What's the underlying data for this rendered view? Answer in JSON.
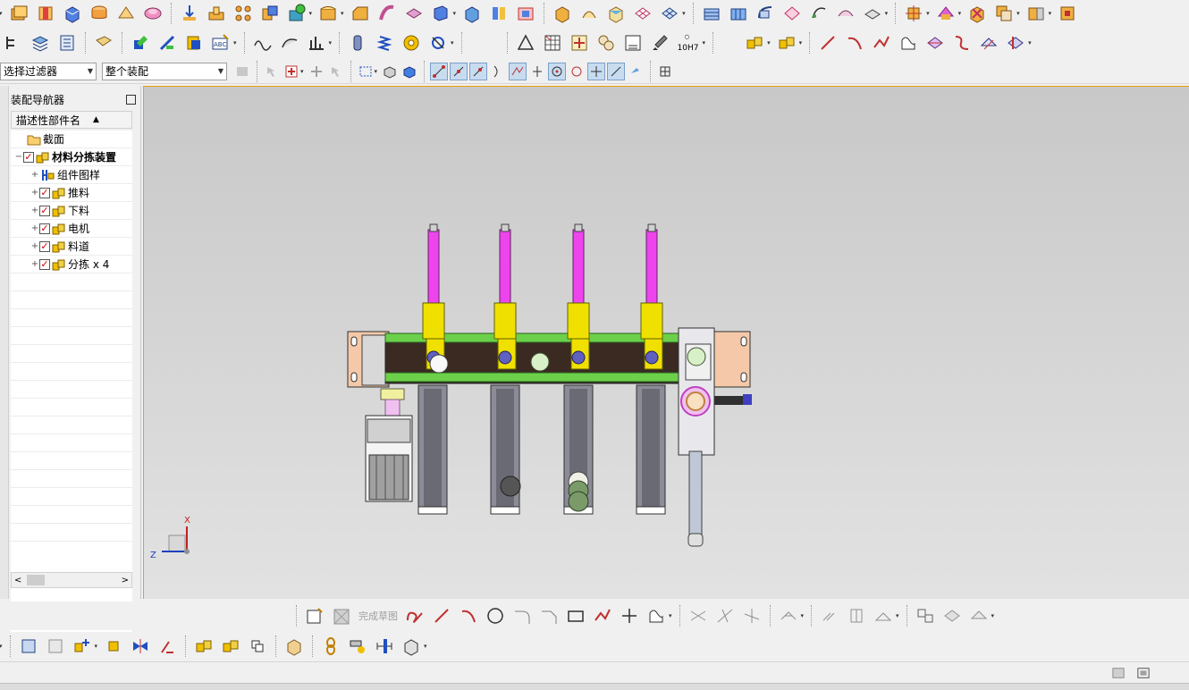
{
  "toolbar": {
    "filter_label": "选择过滤器",
    "scope_label": "整个装配",
    "tolerance_badge": "10H7"
  },
  "navigator": {
    "title": "装配导航器",
    "column_header": "描述性部件名",
    "nodes": [
      {
        "label": "截面",
        "level": 0,
        "checked": false,
        "expander": "",
        "icon": "folder-icon"
      },
      {
        "label": "材料分拣装置",
        "level": 0,
        "checked": true,
        "expander": "−",
        "icon": "assembly-icon",
        "bold": true
      },
      {
        "label": "组件图样",
        "level": 1,
        "checked": false,
        "expander": "+",
        "icon": "drawing-icon"
      },
      {
        "label": "推料",
        "level": 1,
        "checked": true,
        "expander": "+",
        "icon": "assembly-icon"
      },
      {
        "label": "下料",
        "level": 1,
        "checked": true,
        "expander": "+",
        "icon": "assembly-icon"
      },
      {
        "label": "电机",
        "level": 1,
        "checked": true,
        "expander": "+",
        "icon": "assembly-icon"
      },
      {
        "label": "料道",
        "level": 1,
        "checked": true,
        "expander": "+",
        "icon": "assembly-icon"
      },
      {
        "label": "分拣 x 4",
        "level": 1,
        "checked": true,
        "expander": "+",
        "icon": "assembly-icon"
      }
    ]
  },
  "sketch_toolbar": {
    "finish_label": "完成草图"
  },
  "viewport": {
    "triad_x_label": "X",
    "triad_z_label": "Z"
  },
  "colors": {
    "cylinder": "#ee44ee",
    "bracket": "#f0e000",
    "rail": "#6cd04a",
    "beam": "#3a2a22",
    "plate": "#f4c8a8",
    "channel": "#8c8c98",
    "selection_border": "#f0a000"
  }
}
